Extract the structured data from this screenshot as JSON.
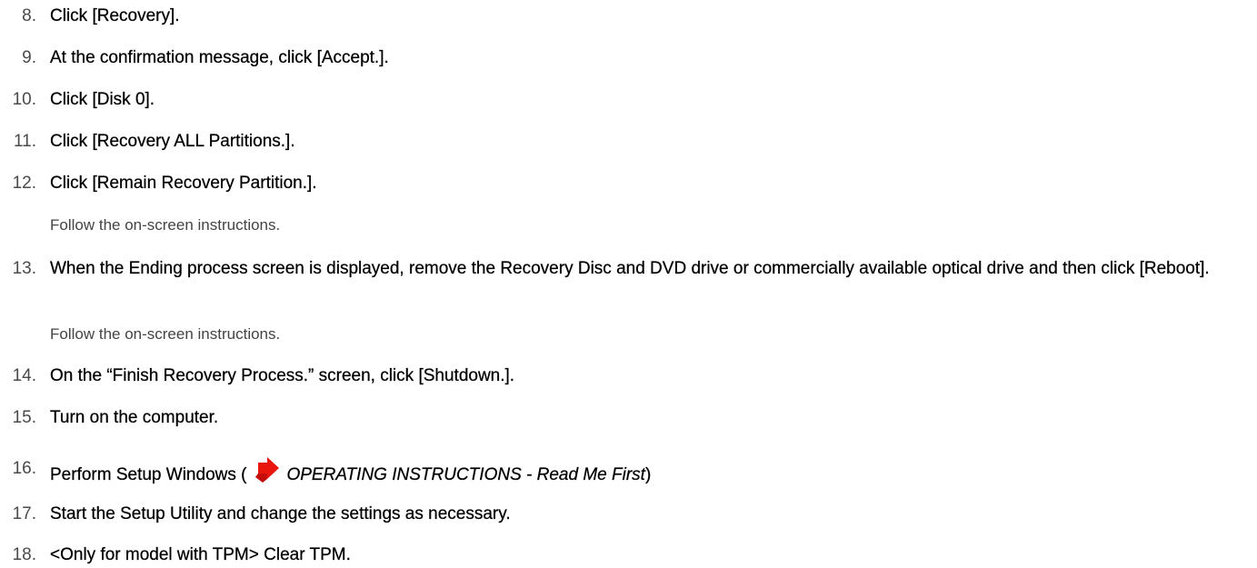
{
  "steps": [
    {
      "num": "8.",
      "text": "Click [Recovery]."
    },
    {
      "num": "9.",
      "text": "At the confirmation message, click [Accept.]."
    },
    {
      "num": "10.",
      "text": "Click [Disk 0]."
    },
    {
      "num": "11.",
      "text": "Click [Recovery ALL Partitions.]."
    },
    {
      "num": "12.",
      "text": "Click [Remain Recovery Partition.].",
      "note": "Follow the on-screen instructions."
    },
    {
      "num": "13.",
      "text": "When the Ending process screen is displayed, remove the Recovery Disc and DVD drive or commercially available optical drive and then click [Reboot].",
      "note": "Follow the on-screen instructions."
    },
    {
      "num": "14.",
      "text": "On the “Finish Recovery Process.” screen, click [Shutdown.]."
    },
    {
      "num": "15.",
      "text": "Turn on the computer."
    },
    {
      "num": "16.",
      "text_before": "Perform Setup Windows (",
      "link": "OPERATING INSTRUCTIONS - Read Me First",
      "text_after": ")",
      "icon": "red-arrow-right-icon"
    },
    {
      "num": "17.",
      "text": "Start the Setup Utility and change the settings as necessary."
    },
    {
      "num": "18.",
      "text": "<Only for model with TPM> Clear TPM."
    }
  ],
  "colors": {
    "arrow": "#e8160c",
    "step_number": "#4a4a4a",
    "note": "#444444"
  }
}
